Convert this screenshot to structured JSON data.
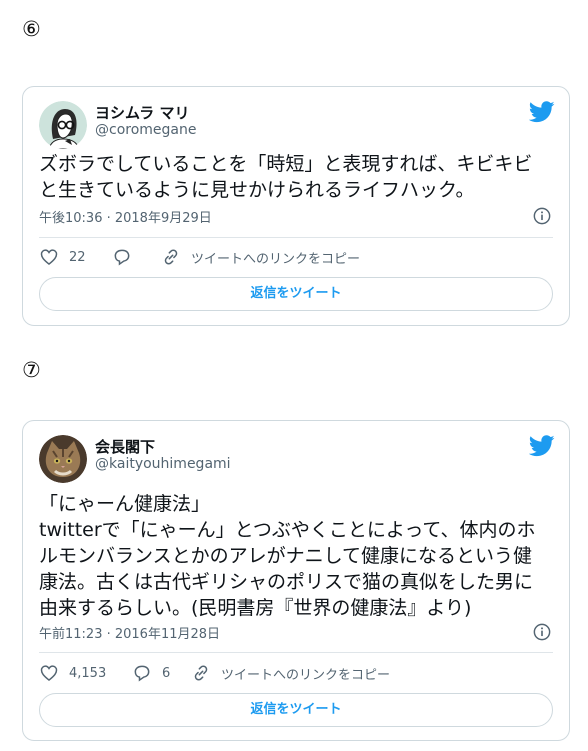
{
  "tweets": [
    {
      "number": "⑥",
      "name": "ヨシムラ マリ",
      "handle": "@coromegane",
      "text": "ズボラでしていることを「時短」と表現すれば、キビキビと生きているように見せかけられるライフハック。",
      "timestamp": "午後10:36 · 2018年9月29日",
      "likes": "22",
      "replies": "",
      "copy_link": "ツイートへのリンクをコピー",
      "reply_button": "返信をツイート"
    },
    {
      "number": "⑦",
      "name": "会長閣下",
      "handle": "@kaityouhimegami",
      "text": "「にゃーん健康法」\ntwitterで「にゃーん」とつぶやくことによって、体内のホルモンバランスとかのアレがナニして健康になるという健康法。古くは古代ギリシャのポリスで猫の真似をした男に由来するらしい。(民明書房『世界の健康法』より)",
      "timestamp": "午前11:23 · 2016年11月28日",
      "likes": "4,153",
      "replies": "6",
      "copy_link": "ツイートへのリンクをコピー",
      "reply_button": "返信をツイート"
    }
  ],
  "colors": {
    "accent": "#1d9bf0",
    "muted": "#536471",
    "border": "#cfd9de"
  },
  "icons": [
    "avatar-glasses-woman",
    "avatar-cat",
    "twitter-bird-icon",
    "heart-icon",
    "reply-icon",
    "link-icon",
    "info-icon"
  ]
}
